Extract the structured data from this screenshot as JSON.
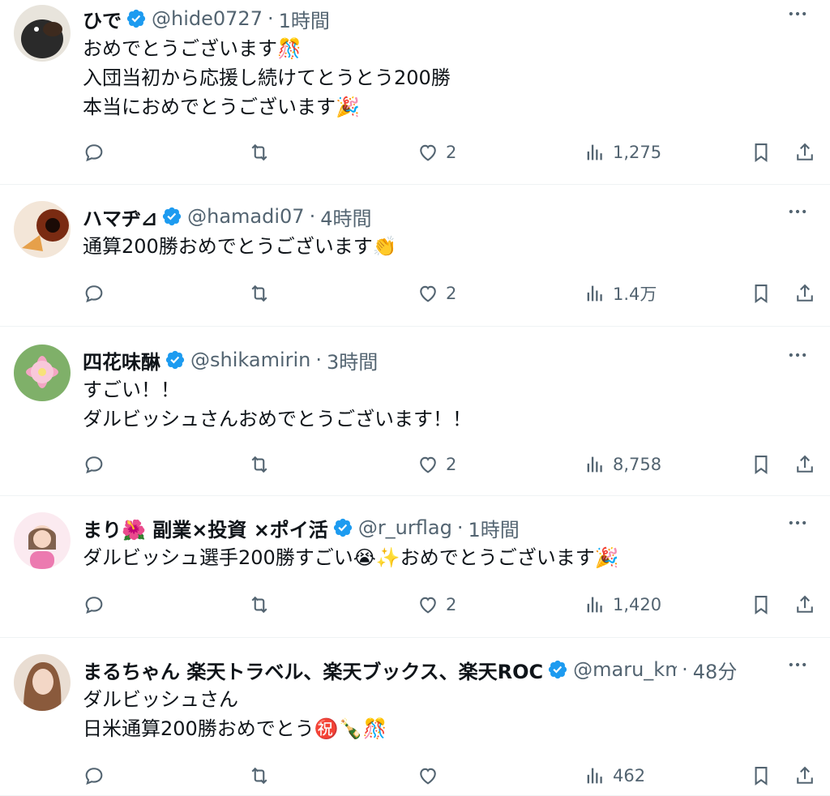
{
  "tweets": [
    {
      "name": "ひで",
      "handle": "@hide0727",
      "time": "1時間",
      "lines": [
        "おめでとうございます🎊",
        "入団当初から応援し続けてとうとう200勝",
        "本当におめでとうございます🎉"
      ],
      "likes": "2",
      "views": "1,275",
      "avatar_color": "#2a2a2a"
    },
    {
      "name": "ハマヂ⊿",
      "handle": "@hamadi07",
      "time": "4時間",
      "lines": [
        "通算200勝おめでとうございます👏"
      ],
      "likes": "2",
      "views": "1.4万",
      "avatar_color": "#8a3a1e"
    },
    {
      "name": "四花味醂",
      "handle": "@shikamirin",
      "time": "3時間",
      "lines": [
        "すごい！！",
        "ダルビッシュさんおめでとうございます！！"
      ],
      "likes": "2",
      "views": "8,758",
      "avatar_color": "#6aa84f"
    },
    {
      "name": "まり🌺 副業×投資 ×ポイ活",
      "handle": "@r_urflag",
      "time": "1時間",
      "lines": [
        "ダルビッシュ選手200勝すごい😭✨おめでとうございます🎉"
      ],
      "likes": "2",
      "views": "1,420",
      "avatar_color": "#f4cccc"
    },
    {
      "name": "まるちゃん 楽天トラベル、楽天ブックス、楽天ROC",
      "handle": "@maru_km",
      "time": "48分",
      "lines": [
        "ダルビッシュさん",
        "日米通算200勝おめでとう㊗️🍾🎊"
      ],
      "likes": "",
      "views": "462",
      "avatar_color": "#c9a58a"
    }
  ],
  "time_separator": "·",
  "accent_color": "#1d9bf0"
}
